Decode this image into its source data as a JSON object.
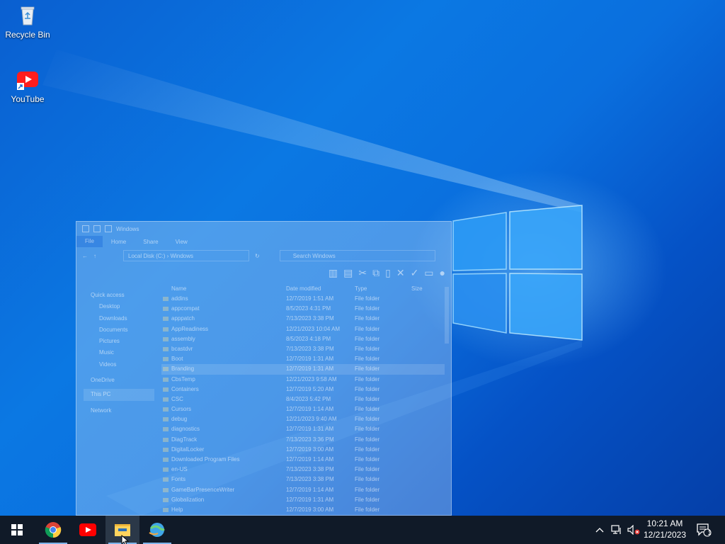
{
  "desktop": {
    "icons": [
      {
        "label": "Recycle Bin",
        "icon": "recycle-bin-icon"
      },
      {
        "label": "YouTube",
        "icon": "youtube-shortcut-icon"
      }
    ]
  },
  "explorer": {
    "title": "Windows",
    "tabs": [
      "File",
      "Home",
      "Share",
      "View"
    ],
    "address": {
      "root": "Local Disk (C:)",
      "folder": "Windows"
    },
    "search_placeholder": "Search Windows",
    "nav": {
      "quick_access": "Quick access",
      "desktop": "Desktop",
      "downloads": "Downloads",
      "documents": "Documents",
      "pictures": "Pictures",
      "music": "Music",
      "videos": "Videos",
      "onedrive": "OneDrive",
      "this_pc": "This PC",
      "network": "Network"
    },
    "columns": {
      "name": "Name",
      "date": "Date modified",
      "type": "Type",
      "size": "Size"
    },
    "files": [
      {
        "name": "addins",
        "date": "12/7/2019 1:51 AM",
        "type": "File folder"
      },
      {
        "name": "appcompat",
        "date": "8/5/2023 4:31 PM",
        "type": "File folder"
      },
      {
        "name": "apppatch",
        "date": "7/13/2023 3:38 PM",
        "type": "File folder"
      },
      {
        "name": "AppReadiness",
        "date": "12/21/2023 10:04 AM",
        "type": "File folder"
      },
      {
        "name": "assembly",
        "date": "8/5/2023 4:18 PM",
        "type": "File folder"
      },
      {
        "name": "bcastdvr",
        "date": "7/13/2023 3:38 PM",
        "type": "File folder"
      },
      {
        "name": "Boot",
        "date": "12/7/2019 1:31 AM",
        "type": "File folder"
      },
      {
        "name": "Branding",
        "date": "12/7/2019 1:31 AM",
        "type": "File folder"
      },
      {
        "name": "CbsTemp",
        "date": "12/21/2023 9:58 AM",
        "type": "File folder"
      },
      {
        "name": "Containers",
        "date": "12/7/2019 5:20 AM",
        "type": "File folder"
      },
      {
        "name": "CSC",
        "date": "8/4/2023 5:42 PM",
        "type": "File folder"
      },
      {
        "name": "Cursors",
        "date": "12/7/2019 1:14 AM",
        "type": "File folder"
      },
      {
        "name": "debug",
        "date": "12/21/2023 9:40 AM",
        "type": "File folder"
      },
      {
        "name": "diagnostics",
        "date": "12/7/2019 1:31 AM",
        "type": "File folder"
      },
      {
        "name": "DiagTrack",
        "date": "7/13/2023 3:36 PM",
        "type": "File folder"
      },
      {
        "name": "DigitalLocker",
        "date": "12/7/2019 3:00 AM",
        "type": "File folder"
      },
      {
        "name": "Downloaded Program Files",
        "date": "12/7/2019 1:14 AM",
        "type": "File folder"
      },
      {
        "name": "en-US",
        "date": "7/13/2023 3:38 PM",
        "type": "File folder"
      },
      {
        "name": "Fonts",
        "date": "7/13/2023 3:38 PM",
        "type": "File folder"
      },
      {
        "name": "GameBarPresenceWriter",
        "date": "12/7/2019 1:14 AM",
        "type": "File folder"
      },
      {
        "name": "Globalization",
        "date": "12/7/2019 1:31 AM",
        "type": "File folder"
      },
      {
        "name": "Help",
        "date": "12/7/2019 3:00 AM",
        "type": "File folder"
      }
    ],
    "selected_row": 7
  },
  "taskbar": {
    "apps": [
      {
        "name": "start",
        "icon": "windows-logo-icon"
      },
      {
        "name": "chrome",
        "icon": "chrome-icon"
      },
      {
        "name": "youtube",
        "icon": "youtube-icon"
      },
      {
        "name": "file-explorer",
        "icon": "folder-icon"
      },
      {
        "name": "app",
        "icon": "globe-app-icon"
      }
    ],
    "clock": {
      "time": "10:21 AM",
      "date": "12/21/2023"
    },
    "notification_count": "1"
  },
  "colors": {
    "taskbar": "#101a28",
    "accent": "#7eb4ea",
    "wallpaper": "#0b78e3"
  }
}
